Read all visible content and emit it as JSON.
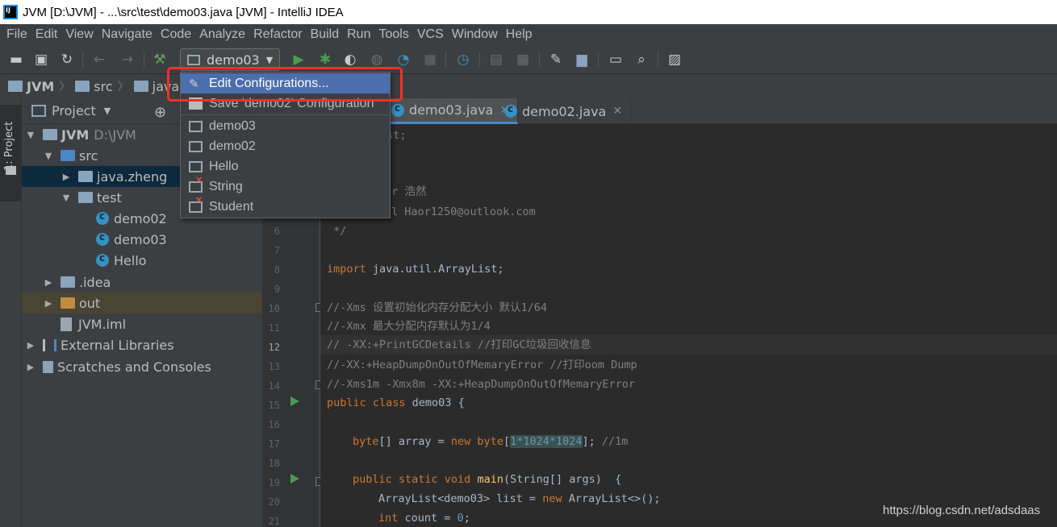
{
  "window": {
    "title": "JVM [D:\\JVM] - ...\\src\\test\\demo03.java [JVM] - IntelliJ IDEA"
  },
  "menu": [
    "File",
    "Edit",
    "View",
    "Navigate",
    "Code",
    "Analyze",
    "Refactor",
    "Build",
    "Run",
    "Tools",
    "VCS",
    "Window",
    "Help"
  ],
  "toolbar": {
    "run_config": "demo03"
  },
  "breadcrumb": [
    "JVM",
    "src",
    "java"
  ],
  "side_strip": {
    "label": "1: Project"
  },
  "project_panel": {
    "header": "Project",
    "tree": [
      {
        "label": "JVM",
        "path": "D:\\JVM"
      },
      {
        "label": "src"
      },
      {
        "label": "java.zheng"
      },
      {
        "label": "test"
      },
      {
        "label": "demo02"
      },
      {
        "label": "demo03"
      },
      {
        "label": "Hello"
      },
      {
        "label": ".idea"
      },
      {
        "label": "out"
      },
      {
        "label": "JVM.iml"
      },
      {
        "label": "External Libraries"
      },
      {
        "label": "Scratches and Consoles"
      }
    ]
  },
  "editor_tabs": [
    {
      "label": "demo03.java",
      "active": true
    },
    {
      "label": "demo02.java",
      "active": false
    }
  ],
  "run_config_popup": {
    "items": [
      {
        "label": "Edit Configurations...",
        "icon": "pencil-icon",
        "selected": true
      },
      {
        "label": "Save 'demo02' Configuration",
        "icon": "save-icon"
      },
      {
        "label": "demo03",
        "icon": "run-config-icon"
      },
      {
        "label": "demo02",
        "icon": "run-config-icon"
      },
      {
        "label": "Hello",
        "icon": "run-config-icon"
      },
      {
        "label": "String",
        "icon": "run-config-error-icon"
      },
      {
        "label": "Student",
        "icon": "run-config-error-icon"
      }
    ]
  },
  "editor": {
    "current_line": "12",
    "partial_lines": {
      "l1": "est;",
      "l4": "hor 浩然",
      "l5": "l Haor1250@outlook.com"
    },
    "lines": [
      {
        "n": "6",
        "text": " */"
      },
      {
        "n": "7",
        "text": ""
      },
      {
        "n": "8",
        "kw": "import",
        "text": " java.util.ArrayList;"
      },
      {
        "n": "9",
        "text": ""
      },
      {
        "n": "10",
        "comment": "//-Xms 设置初始化内存分配大小 默认1/64"
      },
      {
        "n": "11",
        "comment": "//-Xmx 最大分配内存默认为1/4"
      },
      {
        "n": "12",
        "comment": "// -XX:+PrintGCDetails //打印GC垃圾回收信息"
      },
      {
        "n": "13",
        "comment": "//-XX:+HeapDumpOnOutOfMemaryError //打印oom Dump"
      },
      {
        "n": "14",
        "comment": "//-Xms1m -Xmx8m -XX:+HeapDumpOnOutOfMemaryError"
      },
      {
        "n": "15",
        "kw": "public class",
        "text": " demo03 {"
      },
      {
        "n": "16",
        "text": ""
      },
      {
        "n": "17",
        "kw": "byte",
        "text": "[] array = ",
        "kw2": "new byte",
        "open": "[",
        "hl": "1*1024*1024",
        "close": "];",
        "tail_comment": " //1m"
      },
      {
        "n": "18",
        "text": ""
      },
      {
        "n": "19",
        "kw": "public static void",
        "fn": " main",
        "text": "(String[] args)  {"
      },
      {
        "n": "20",
        "text": "ArrayList<demo03> list = ",
        "kw2": "new",
        "text2": " ArrayList<>();"
      },
      {
        "n": "21",
        "kw": "int",
        "text": " count = ",
        "num": "0",
        "text2": ";"
      }
    ]
  },
  "watermark": "https://blog.csdn.net/adsdaas"
}
